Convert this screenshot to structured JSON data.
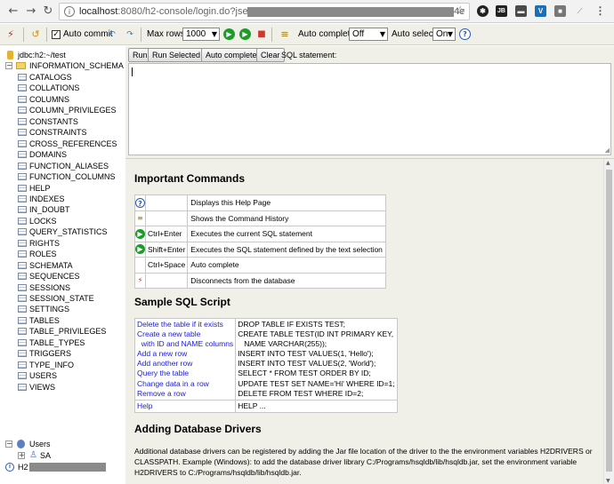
{
  "browser": {
    "url_host": "localhost",
    "url_path": ":8080/h2-console/login.do?jsessionid=5c",
    "url_tail": "4e"
  },
  "toolbar": {
    "auto_commit_label": "Auto commit",
    "max_rows_label": "Max rows:",
    "max_rows_value": "1000",
    "auto_complete_label": "Auto complete",
    "auto_complete_value": "Off",
    "auto_select_label": "Auto select",
    "auto_select_value": "On",
    "help_icon": "?"
  },
  "tree": {
    "connection": "jdbc:h2:~/test",
    "schema": "INFORMATION_SCHEMA",
    "tables": [
      "CATALOGS",
      "COLLATIONS",
      "COLUMNS",
      "COLUMN_PRIVILEGES",
      "CONSTANTS",
      "CONSTRAINTS",
      "CROSS_REFERENCES",
      "DOMAINS",
      "FUNCTION_ALIASES",
      "FUNCTION_COLUMNS",
      "HELP",
      "INDEXES",
      "IN_DOUBT",
      "LOCKS",
      "QUERY_STATISTICS",
      "RIGHTS",
      "ROLES",
      "SCHEMATA",
      "SEQUENCES",
      "SESSIONS",
      "SESSION_STATE",
      "SETTINGS",
      "TABLES",
      "TABLE_PRIVILEGES",
      "TABLE_TYPES",
      "TRIGGERS",
      "TYPE_INFO",
      "USERS",
      "VIEWS"
    ],
    "users_label": "Users",
    "user_sa": "SA",
    "version_label": "H2"
  },
  "query": {
    "run": "Run",
    "run_selected": "Run Selected",
    "auto_complete": "Auto complete",
    "clear": "Clear",
    "sql_statement_label": "SQL statement:"
  },
  "help": {
    "important_title": "Important Commands",
    "commands": [
      {
        "icon": "help-icon",
        "key": "",
        "desc": "Displays this Help Page"
      },
      {
        "icon": "history-icon",
        "key": "",
        "desc": "Shows the Command History"
      },
      {
        "icon": "run-icon",
        "key": "Ctrl+Enter",
        "desc": "Executes the current SQL statement"
      },
      {
        "icon": "run-selected-icon",
        "key": "Shift+Enter",
        "desc": "Executes the SQL statement defined by the text selection"
      },
      {
        "icon": "",
        "key": "Ctrl+Space",
        "desc": "Auto complete"
      },
      {
        "icon": "disconnect-icon",
        "key": "",
        "desc": "Disconnects from the database"
      }
    ],
    "sample_title": "Sample SQL Script",
    "sample": [
      {
        "action": "Delete the table if it exists",
        "sql": "DROP TABLE IF EXISTS TEST;"
      },
      {
        "action": "Create a new table",
        "sql": "CREATE TABLE TEST(ID INT PRIMARY KEY,"
      },
      {
        "action": "  with ID and NAME columns",
        "sql": "   NAME VARCHAR(255));"
      },
      {
        "action": "Add a new row",
        "sql": "INSERT INTO TEST VALUES(1, 'Hello');"
      },
      {
        "action": "Add another row",
        "sql": "INSERT INTO TEST VALUES(2, 'World');"
      },
      {
        "action": "Query the table",
        "sql": "SELECT * FROM TEST ORDER BY ID;"
      },
      {
        "action": "Change data in a row",
        "sql": "UPDATE TEST SET NAME='Hi' WHERE ID=1;"
      },
      {
        "action": "Remove a row",
        "sql": "DELETE FROM TEST WHERE ID=2;"
      }
    ],
    "help_row": {
      "action": "Help",
      "sql": "HELP ..."
    },
    "drivers_title": "Adding Database Drivers",
    "drivers_text": "Additional database drivers can be registered by adding the Jar file location of the driver to the the environment variables H2DRIVERS or CLASSPATH. Example (Windows): to add the database driver library C:/Programs/hsqldb/lib/hsqldb.jar, set the environment variable H2DRIVERS to C:/Programs/hsqldb/lib/hsqldb.jar."
  },
  "colors": {
    "panel_bg": "#f0f0e8",
    "link": "#1a1adf",
    "run_green": "#1c9c2a",
    "stop_red": "#d8342a"
  }
}
